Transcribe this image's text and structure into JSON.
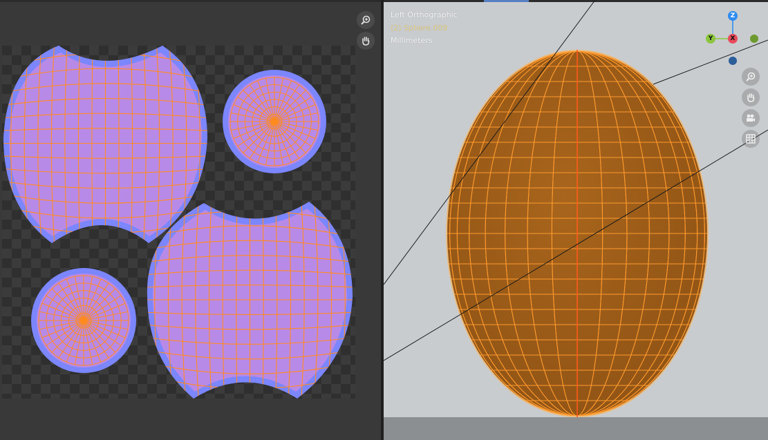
{
  "uv_editor": {
    "zoom_icon": "zoom-icon",
    "hand_icon": "hand-icon"
  },
  "viewport": {
    "view_label": "Left Orthographic",
    "object_label": "(2) Sphere.009",
    "units_label": "Millimeters",
    "gizmo": {
      "z": "Z",
      "y": "Y",
      "x": "X"
    },
    "colors": {
      "background": "#c9cccf",
      "object_fill": "#a8651c",
      "wire": "#ff9a2e",
      "z_axis": "#2f8cf0",
      "y_axis": "#8cc63f",
      "x_axis": "#e84b5c"
    },
    "nav_icons": [
      "zoom-icon",
      "hand-icon",
      "camera-icon",
      "grid-icon"
    ]
  },
  "uv_colors": {
    "island_fill": "#b88ae8",
    "island_border": "#7b86ff",
    "edge": "#ff8a1e",
    "checker_a": "#2f2f2f",
    "checker_b": "#3c3c3c"
  }
}
